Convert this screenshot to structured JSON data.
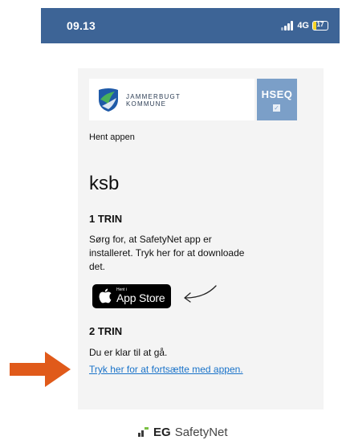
{
  "status_bar": {
    "time": "09.13",
    "network": "4G",
    "battery": "17",
    "battery_color": "#f5d328",
    "background": "#3d6496"
  },
  "header": {
    "org_name_line1": "JAMMERBUGT",
    "org_name_line2": "KOMMUNE",
    "hseq_logo": "HSEQ",
    "hseq_check": "✓"
  },
  "main": {
    "get_app_label": "Hent appen",
    "title": "ksb",
    "step1": {
      "heading": "1 TRIN",
      "text": "Sørg for, at SafetyNet app er installeret. Tryk her for at downloade det."
    },
    "app_store_badge": {
      "small_text": "Hent i",
      "big_text": "App Store"
    },
    "step2": {
      "heading": "2 TRIN",
      "text": "Du er klar til at gå.",
      "link": "Tryk her for at fortsætte med appen."
    },
    "link_color": "#1a73c9",
    "annotation_arrow_color": "#e05a1a"
  },
  "footer": {
    "brand": "EG",
    "product": "SafetyNet"
  },
  "icons": [
    "signal-icon",
    "battery-icon",
    "jammerbugt-emblem-icon",
    "hseq-logo",
    "apple-icon",
    "hand-drawn-arrow-icon",
    "orange-arrow-icon",
    "eg-logo-icon"
  ]
}
